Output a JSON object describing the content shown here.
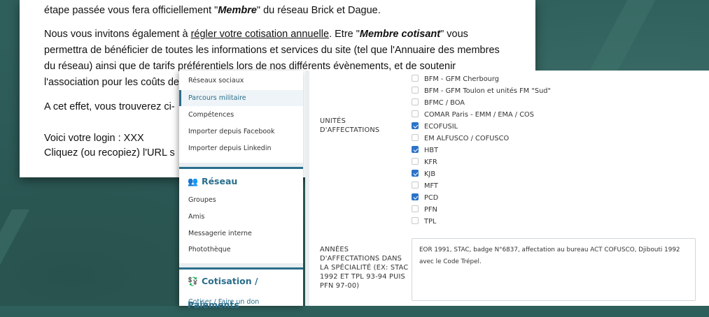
{
  "email": {
    "line1_pre": "étape passée vous fera officiellement \"",
    "line1_bold": "Membre",
    "line1_post": "\" du réseau Brick et Dague.",
    "line2_pre": "Nous vous invitons également à ",
    "line2_link": "régler votre cotisation annuelle",
    "line2_mid": ". Etre \"",
    "line2_bold": "Membre cotisant",
    "line2_post": "\" vous",
    "line3": "permettra de bénéficier de toutes les informations et services du site (tel que l'Annuaire des membres",
    "line4": "du réseau) ainsi que de tarifs préférentiels lors de nos différents évènements, et de soutenir",
    "line5": "l'association pour les coûts de",
    "line6": "A cet effet, vous trouverez ci-",
    "line7": "Voici votre login : XXX",
    "line8": "Cliquez (ou recopiez) l'URL s"
  },
  "sidebar": {
    "items_top": [
      {
        "label": "Réseaux sociaux"
      },
      {
        "label": "Parcours militaire"
      },
      {
        "label": "Compétences"
      },
      {
        "label": "Importer depuis Facebook"
      },
      {
        "label": "Importer depuis Linkedin"
      }
    ],
    "section_reseau": "Réseau",
    "items_reseau": [
      {
        "label": "Groupes"
      },
      {
        "label": "Amis"
      },
      {
        "label": "Messagerie interne"
      },
      {
        "label": "Photothèque"
      }
    ],
    "section_cotisation": "Cotisation / Paiements",
    "items_cotisation": [
      {
        "label": "Cotiser / Faire un don"
      }
    ]
  },
  "form": {
    "unites_label": "Unités d'affectations",
    "unites": [
      {
        "label": "BFM - GFM Cherbourg",
        "checked": false
      },
      {
        "label": "BFM - GFM Toulon et unités FM \"Sud\"",
        "checked": false
      },
      {
        "label": "BFMC / BOA",
        "checked": false
      },
      {
        "label": "COMAR Paris - EMM / EMA / COS",
        "checked": false
      },
      {
        "label": "ECOFUSIL",
        "checked": true
      },
      {
        "label": "EM ALFUSCO / COFUSCO",
        "checked": false
      },
      {
        "label": "HBT",
        "checked": true
      },
      {
        "label": "KFR",
        "checked": false
      },
      {
        "label": "KJB",
        "checked": true
      },
      {
        "label": "MFT",
        "checked": false
      },
      {
        "label": "PCD",
        "checked": true
      },
      {
        "label": "PFN",
        "checked": false
      },
      {
        "label": "TPL",
        "checked": false
      }
    ],
    "annees_label": "Années d'affectations dans la spécialité (ex: STAC 1992 et TPL 93-94 puis PFN 97-00)",
    "annees_value": "EOR 1991, STAC, badge N°6837, affectation au bureau ACT COFUSCO, Djibouti 1992 avec le Code Trépel."
  },
  "colors": {
    "accent": "#2a6e8c",
    "checkbox_checked": "#2b73c8",
    "background": "#2f5f5b"
  }
}
